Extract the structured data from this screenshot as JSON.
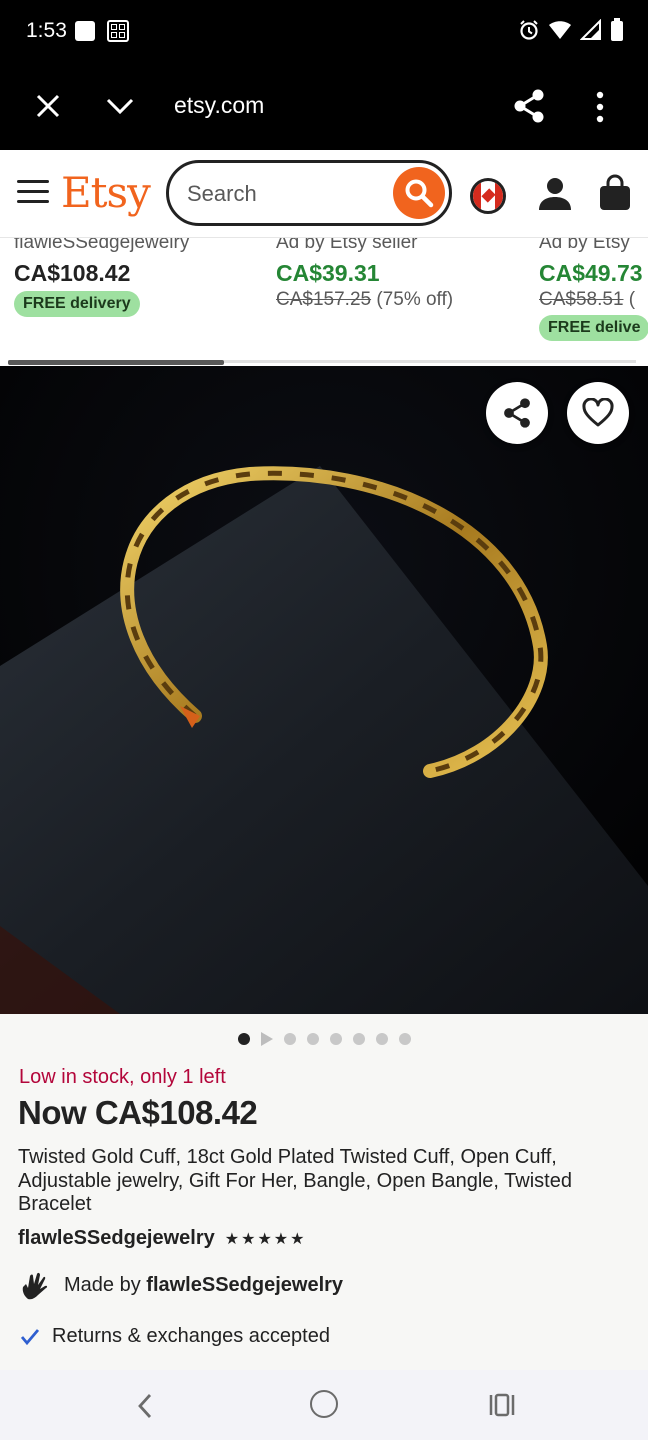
{
  "status_bar": {
    "time": "1:53"
  },
  "browser": {
    "url": "etsy.com"
  },
  "header": {
    "logo": "Etsy",
    "search_placeholder": "Search"
  },
  "recommendations": [
    {
      "seller": "flawleSSedgejewelry",
      "price": "CA$108.42",
      "original_price": "",
      "discount": "",
      "badge": "FREE delivery"
    },
    {
      "seller": "Ad by Etsy seller",
      "price": "CA$39.31",
      "original_price": "CA$157.25",
      "discount": "(75% off)",
      "badge": ""
    },
    {
      "seller": "Ad by Etsy",
      "price": "CA$49.73",
      "original_price": "CA$58.51",
      "discount": "(",
      "badge": "FREE delive"
    }
  ],
  "carousel": {
    "total": 8,
    "active_index": 0
  },
  "product": {
    "stock_notice": "Low in stock, only 1 left",
    "price": "Now CA$108.42",
    "title": "Twisted Gold Cuff, 18ct Gold Plated Twisted Cuff, Open Cuff, Adjustable jewelry, Gift For Her, Bangle, Open Bangle, Twisted Bracelet",
    "shop_name": "flawleSSedgejewelry",
    "rating_stars": 5,
    "rating_text": "★★★★★",
    "made_by_prefix": "Made by",
    "made_by_shop": "flawleSSedgejewelry",
    "returns": "Returns & exchanges accepted"
  },
  "colors": {
    "brand": "#f1641e",
    "sale_green": "#258635",
    "stock_red": "#b3063a",
    "badge_green": "#9ee0a0",
    "check_blue": "#2f5fd0"
  }
}
